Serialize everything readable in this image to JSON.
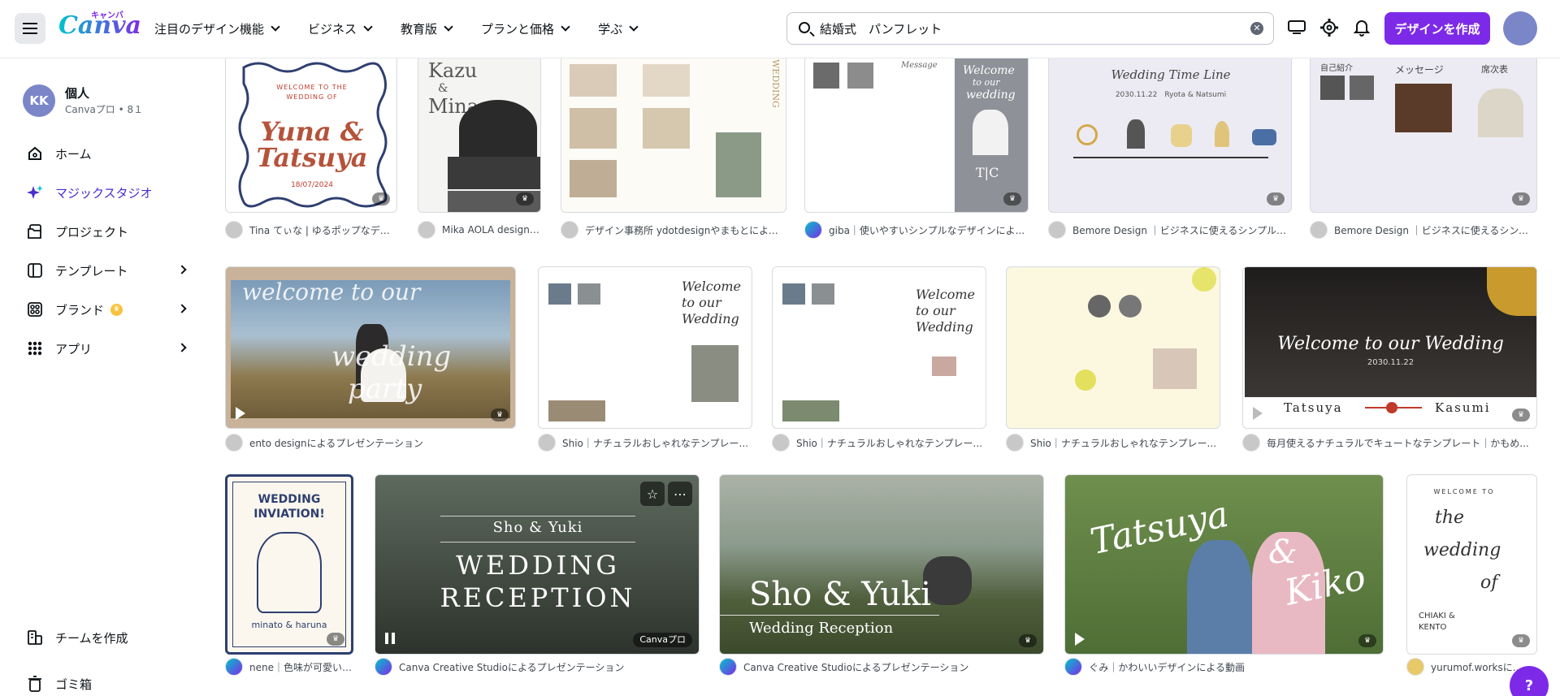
{
  "header": {
    "logo": "Canva",
    "logo_kana": "キャンバ",
    "nav": [
      "注目のデザイン機能",
      "ビジネス",
      "教育版",
      "プランと価格",
      "学ぶ"
    ],
    "search_value": "結婚式　パンフレット",
    "create_button": "デザインを作成"
  },
  "sidebar": {
    "account": {
      "initials": "KK",
      "name": "個人",
      "sub": "Canvaプロ • 8１"
    },
    "items": [
      {
        "label": "ホーム"
      },
      {
        "label": "マジックスタジオ"
      },
      {
        "label": "プロジェクト"
      },
      {
        "label": "テンプレート"
      },
      {
        "label": "ブランド"
      },
      {
        "label": "アプリ"
      }
    ],
    "bottom": [
      {
        "label": "チームを作成"
      },
      {
        "label": "ゴミ箱"
      }
    ]
  },
  "thumbs": {
    "r1c1": {
      "line1": "WELCOME TO THE",
      "line2": "WEDDING OF",
      "names1": "Yuna &",
      "names2": "Tatsuya",
      "date": "18/07/2024"
    },
    "r1c2": {
      "n1": "Kazu",
      "amp": "&",
      "n2": "Mina"
    },
    "r1c3": {
      "side": "WEDDING"
    },
    "r1c4": {
      "greeting": "Message",
      "welcome1": "Welcome",
      "welcome2": "to our",
      "welcome3": "wedding",
      "initials": "T|C"
    },
    "r1c5": {
      "title": "Wedding Time Line",
      "date": "2030.11.22　Ryota & Natsumi"
    },
    "r1c6": {
      "h1": "自己紹介",
      "h2": "メッセージ",
      "h3": "席次表"
    },
    "r2c1": {
      "script1": "welcome to our",
      "script2": "wedding",
      "script3": "party"
    },
    "r2c2": {
      "script": "Welcome to our Wedding"
    },
    "r2c3": {
      "script": "Welcome to our Wedding"
    },
    "r2c5": {
      "title": "Welcome to our Wedding",
      "date": "2030.11.22",
      "groom": "Tatsuya",
      "bride": "Kasumi"
    },
    "r3c1": {
      "title1": "WEDDING",
      "title2": "INVIATION!",
      "names": "minato & haruna"
    },
    "r3c2": {
      "names": "Sho & Yuki",
      "t1": "WEDDING",
      "t2": "RECEPTION",
      "badge": "Canvaプロ"
    },
    "r3c3": {
      "names": "Sho & Yuki",
      "sub": "Wedding Reception"
    },
    "r3c4": {
      "script1": "Tatsuya",
      "script2": "&",
      "script3": "Kiko"
    },
    "r3c5": {
      "w1": "WELCOME TO",
      "w2": "the",
      "w3": "wedding",
      "w4": "of",
      "names": "CHIAKI &",
      "names2": "KENTO"
    }
  },
  "captions": [
    "Tina てぃな | ゆるポップなデザ...",
    "Mika AOLA design ...",
    "デザイン事務所 ydotdesignやまもとによる...",
    "giba｜使いやすいシンプルなデザインによ...",
    "Bemore Design ｜ビジネスに使えるシンプル・...",
    "Bemore Design ｜ビジネスに使えるシンプ...",
    "ento designによるプレゼンテーション",
    "Shio｜ナチュラルおしゃれなテンプレー...",
    "Shio｜ナチュラルおしゃれなテンプレー...",
    "Shio｜ナチュラルおしゃれなテンプレー...",
    "毎月使えるナチュラルでキュートなテンプレート｜かもめ...",
    "nene｜色味が可愛い ...",
    "Canva Creative Studioによるプレゼンテーション",
    "Canva Creative Studioによるプレゼンテーション",
    "ぐみ｜かわいいデザインによる動画",
    "yurumof.worksに..."
  ],
  "colors": {
    "accent": "#7d2ae8",
    "active": "#4a2dcf"
  },
  "help": "?"
}
